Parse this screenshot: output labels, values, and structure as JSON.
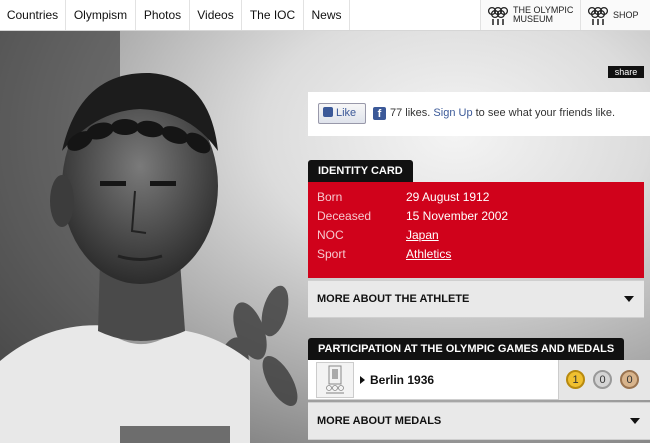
{
  "nav": {
    "items": [
      "Countries",
      "Olympism",
      "Photos",
      "Videos",
      "The IOC",
      "News"
    ],
    "museum_line1": "THE OLYMPIC",
    "museum_line2": "MUSEUM",
    "shop": "SHOP"
  },
  "share_label": "share",
  "social": {
    "like_button": "Like",
    "fb_glyph": "f",
    "like_count": "77 likes.",
    "signup": "Sign Up",
    "suffix": "to see what your friends like."
  },
  "identity": {
    "tab": "IDENTITY CARD",
    "rows": [
      {
        "label": "Born",
        "value": "29 August 1912"
      },
      {
        "label": "Deceased",
        "value": "15 November 2002"
      },
      {
        "label": "NOC",
        "value": "Japan"
      },
      {
        "label": "Sport",
        "value": "Athletics"
      }
    ],
    "more": "MORE ABOUT THE ATHLETE"
  },
  "participation": {
    "tab": "PARTICIPATION AT THE OLYMPIC GAMES AND MEDALS",
    "games": [
      {
        "name": "Berlin 1936",
        "gold": "1",
        "silver": "0",
        "bronze": "0"
      }
    ],
    "more": "MORE ABOUT MEDALS"
  },
  "colors": {
    "accent_red": "#d0021b",
    "gold": "#f0c030",
    "silver": "#d4d4d4",
    "bronze": "#d8b48c"
  }
}
